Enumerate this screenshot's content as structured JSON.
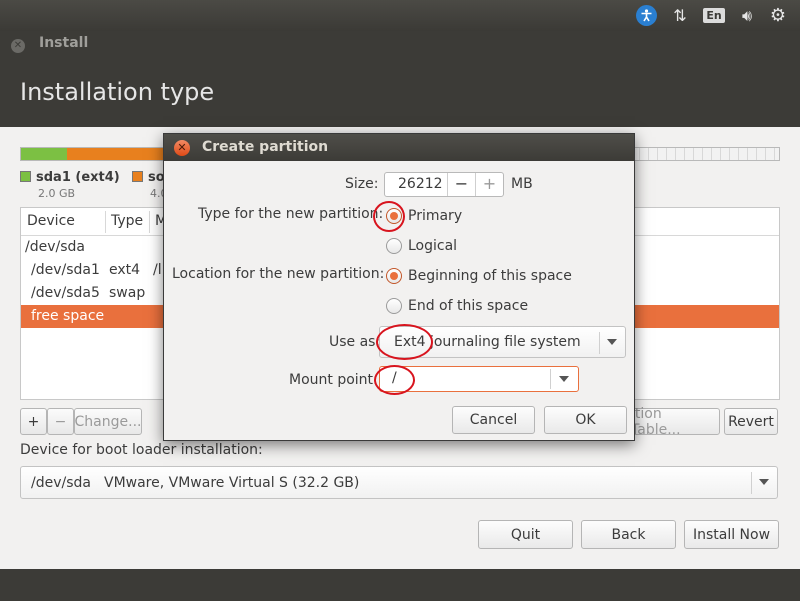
{
  "panel": {
    "keyboard_layout": "En",
    "icons": [
      "accessibility-icon",
      "network-icon",
      "keyboard-icon",
      "volume-icon",
      "gear-icon"
    ]
  },
  "window": {
    "title": "Install",
    "page_title": "Installation type"
  },
  "partition_bar": {
    "legend": [
      {
        "name": "sda1 (ext4)",
        "size": "2.0 GB",
        "color": "#7cc043"
      },
      {
        "name": "so",
        "size": "4.0",
        "color": "#e8801e"
      }
    ]
  },
  "table": {
    "columns": [
      "Device",
      "Type",
      "M"
    ],
    "rows": [
      {
        "device": "/dev/sda",
        "type": "",
        "mount": ""
      },
      {
        "device": "/dev/sda1",
        "type": "ext4",
        "mount": "/l"
      },
      {
        "device": "/dev/sda5",
        "type": "swap",
        "mount": ""
      },
      {
        "device": "free space",
        "type": "",
        "mount": ""
      }
    ]
  },
  "table_buttons": {
    "add": "+",
    "remove": "−",
    "change": "Change...",
    "new_table": "ition Table...",
    "revert": "Revert"
  },
  "bootloader": {
    "label": "Device for boot loader installation:",
    "device": "/dev/sda",
    "description": "VMware, VMware Virtual S (32.2 GB)"
  },
  "actions": {
    "quit": "Quit",
    "back": "Back",
    "install": "Install Now"
  },
  "dialog": {
    "title": "Create partition",
    "size_label": "Size:",
    "size_value": "26212",
    "size_minus": "−",
    "size_plus": "+",
    "size_unit": "MB",
    "type_label": "Type for the new partition:",
    "type_primary": "Primary",
    "type_logical": "Logical",
    "location_label": "Location for the new partition:",
    "location_beginning": "Beginning of this space",
    "location_end": "End of this space",
    "use_as_label": "Use as:",
    "use_as_value": "Ext4 journaling file system",
    "mount_label": "Mount point:",
    "mount_value": "/",
    "cancel": "Cancel",
    "ok": "OK"
  },
  "colors": {
    "accent": "#e9703d",
    "annotation": "#d8141e"
  }
}
